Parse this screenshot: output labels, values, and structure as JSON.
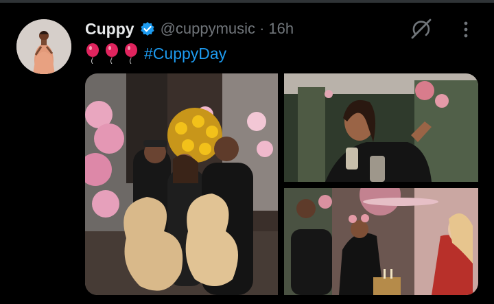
{
  "tweet": {
    "display_name": "Cuppy",
    "handle": "@cuppymusic",
    "separator": "·",
    "time": "16h",
    "balloons": [
      "balloon",
      "balloon",
      "balloon"
    ],
    "hashtag": "#CuppyDay",
    "colors": {
      "link": "#1d9bf0",
      "verified": "#1d9bf0",
      "muted": "#71767b",
      "text": "#e7e9ea",
      "balloon": "#e0245e"
    },
    "icons": {
      "verified": "verified-badge-icon",
      "grok": "grok-icon",
      "more": "more-vertical-icon",
      "balloon": "balloon-emoji"
    },
    "media_count": 3
  }
}
